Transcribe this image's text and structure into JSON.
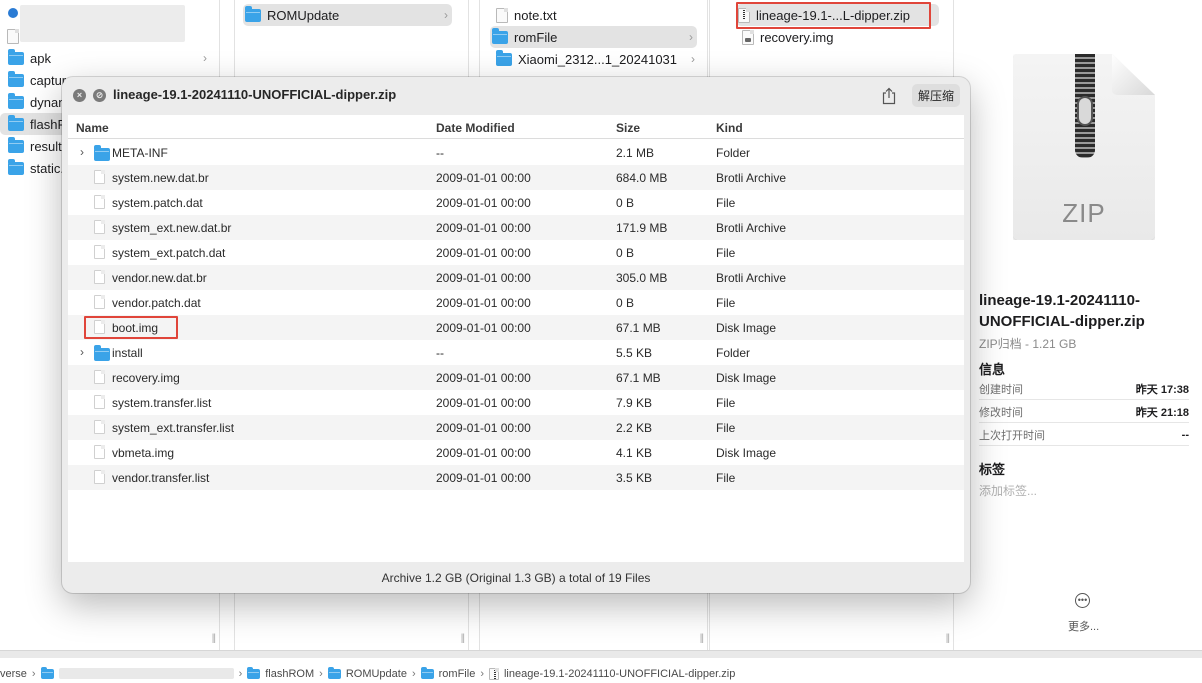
{
  "columns": {
    "col1": {
      "items": [
        {
          "label": "apk",
          "has_children": true
        },
        {
          "label": "captur",
          "has_children": false
        },
        {
          "label": "dynan",
          "has_children": false
        },
        {
          "label": "flashR",
          "has_children": false,
          "selected": true
        },
        {
          "label": "result",
          "has_children": false
        },
        {
          "label": "static.",
          "has_children": false
        }
      ]
    },
    "col2": {
      "items": [
        {
          "label": "ROMUpdate",
          "selected": true
        }
      ]
    },
    "col3": {
      "items": [
        {
          "label": "note.txt",
          "type": "file"
        },
        {
          "label": "romFile",
          "type": "folder",
          "selected": true
        },
        {
          "label": "Xiaomi_2312...1_20241031",
          "type": "folder"
        }
      ]
    },
    "col4": {
      "items": [
        {
          "label": "lineage-19.1-...L-dipper.zip",
          "type": "zip",
          "selected": true
        },
        {
          "label": "recovery.img",
          "type": "img"
        }
      ]
    }
  },
  "archive": {
    "title": "lineage-19.1-20241110-UNOFFICIAL-dipper.zip",
    "extract_label": "解压缩",
    "headers": {
      "name": "Name",
      "date": "Date Modified",
      "size": "Size",
      "kind": "Kind"
    },
    "rows": [
      {
        "name": "META-INF",
        "date": "--",
        "size": "2.1 MB",
        "kind": "Folder",
        "folder": true
      },
      {
        "name": "system.new.dat.br",
        "date": "2009-01-01 00:00",
        "size": "684.0 MB",
        "kind": "Brotli Archive"
      },
      {
        "name": "system.patch.dat",
        "date": "2009-01-01 00:00",
        "size": "0 B",
        "kind": "File"
      },
      {
        "name": "system_ext.new.dat.br",
        "date": "2009-01-01 00:00",
        "size": "171.9 MB",
        "kind": "Brotli Archive"
      },
      {
        "name": "system_ext.patch.dat",
        "date": "2009-01-01 00:00",
        "size": "0 B",
        "kind": "File"
      },
      {
        "name": "vendor.new.dat.br",
        "date": "2009-01-01 00:00",
        "size": "305.0 MB",
        "kind": "Brotli Archive"
      },
      {
        "name": "vendor.patch.dat",
        "date": "2009-01-01 00:00",
        "size": "0 B",
        "kind": "File"
      },
      {
        "name": "boot.img",
        "date": "2009-01-01 00:00",
        "size": "67.1 MB",
        "kind": "Disk Image",
        "highlighted": true
      },
      {
        "name": "install",
        "date": "--",
        "size": "5.5 KB",
        "kind": "Folder",
        "folder": true
      },
      {
        "name": "recovery.img",
        "date": "2009-01-01 00:00",
        "size": "67.1 MB",
        "kind": "Disk Image"
      },
      {
        "name": "system.transfer.list",
        "date": "2009-01-01 00:00",
        "size": "7.9 KB",
        "kind": "File"
      },
      {
        "name": "system_ext.transfer.list",
        "date": "2009-01-01 00:00",
        "size": "2.2 KB",
        "kind": "File"
      },
      {
        "name": "vbmeta.img",
        "date": "2009-01-01 00:00",
        "size": "4.1 KB",
        "kind": "Disk Image"
      },
      {
        "name": "vendor.transfer.list",
        "date": "2009-01-01 00:00",
        "size": "3.5 KB",
        "kind": "File"
      }
    ],
    "status": "Archive 1.2 GB (Original 1.3 GB) a total of 19 Files"
  },
  "preview": {
    "icon_label": "ZIP",
    "filename": "lineage-19.1-20241110-UNOFFICIAL-dipper.zip",
    "subtitle": "ZIP归档 - 1.21 GB",
    "info_heading": "信息",
    "info": [
      {
        "label": "创建时间",
        "value": "昨天 17:38"
      },
      {
        "label": "修改时间",
        "value": "昨天 21:18"
      },
      {
        "label": "上次打开时间",
        "value": "--"
      }
    ],
    "tags_heading": "标签",
    "tags_placeholder": "添加标签...",
    "more_label": "更多..."
  },
  "pathbar": {
    "prefix": "verse",
    "segments": [
      "flashROM",
      "ROMUpdate",
      "romFile",
      "lineage-19.1-20241110-UNOFFICIAL-dipper.zip"
    ]
  },
  "colors": {
    "folder": "#3aa3e8",
    "selection": "#e3e3e3",
    "highlight": "#e0453a",
    "row_alt": "#f4f4f4"
  }
}
